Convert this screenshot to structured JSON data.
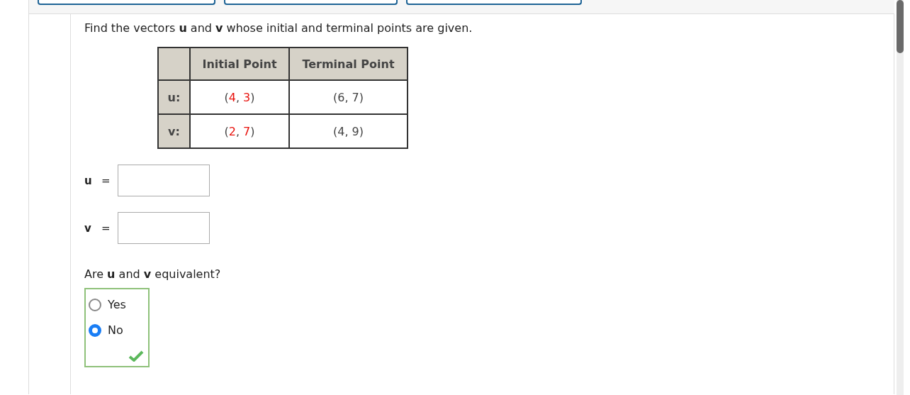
{
  "prompt": "Find the vectors **u** and **v** whose initial and terminal points are given.",
  "table": {
    "columns": [
      "Initial Point",
      "Terminal Point"
    ],
    "rows": [
      {
        "label": "u:",
        "initial": [
          {
            "text": "(",
            "highlighted": false
          },
          {
            "text": "4",
            "highlighted": true
          },
          {
            "text": ", ",
            "highlighted": false
          },
          {
            "text": "3",
            "highlighted": true
          },
          {
            "text": ")",
            "highlighted": false
          }
        ],
        "terminal": "(6, 7)"
      },
      {
        "label": "v:",
        "initial": [
          {
            "text": "(",
            "highlighted": false
          },
          {
            "text": "2",
            "highlighted": true
          },
          {
            "text": ", ",
            "highlighted": false
          },
          {
            "text": "7",
            "highlighted": true
          },
          {
            "text": ")",
            "highlighted": false
          }
        ],
        "terminal": "(4, 9)"
      }
    ]
  },
  "answers": [
    {
      "label": "u",
      "sign": "="
    },
    {
      "label": "v",
      "sign": "="
    }
  ],
  "question": {
    "text": "Are **u** and **v** equivalent?",
    "correct": true,
    "options": [
      {
        "label": "Yes",
        "selected": false
      },
      {
        "label": "No",
        "selected": true
      }
    ]
  }
}
